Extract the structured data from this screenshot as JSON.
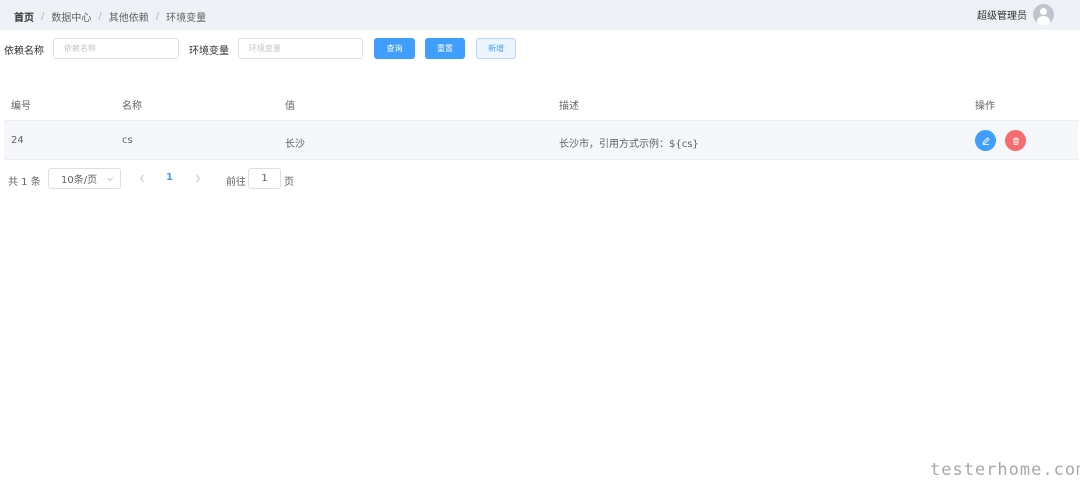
{
  "breadcrumb": [
    "首页",
    "数据中心",
    "其他依赖",
    "环境变量"
  ],
  "breadcrumb_separator": "/",
  "user": {
    "name": "超级管理员"
  },
  "search": {
    "dep_name_label": "依赖名称",
    "dep_name_placeholder": "依赖名称",
    "env_label": "环境变量",
    "env_placeholder": "环境变量",
    "query_label": "查询",
    "reset_label": "重置",
    "add_label": "新增"
  },
  "table": {
    "headers": [
      "编号",
      "名称",
      "值",
      "描述",
      "操作"
    ],
    "rows": [
      {
        "id": "24",
        "name": "cs",
        "value": "长沙",
        "desc": "长沙市，引用方式示例：${cs}"
      }
    ]
  },
  "pagination": {
    "total_text": "共 1 条",
    "page_size": "10条/页",
    "current_page": "1",
    "jump_prefix": "前往",
    "jump_value": "1",
    "jump_suffix": "页"
  },
  "watermark": "testerhome.com",
  "colors": {
    "primary": "#409eff",
    "danger": "#f56c6c",
    "topbar": "#eef1f5",
    "row_bg": "#f5f7fa"
  },
  "icons": {
    "edit": "pencil-icon",
    "delete": "trash-icon",
    "avatar": "user-icon"
  }
}
